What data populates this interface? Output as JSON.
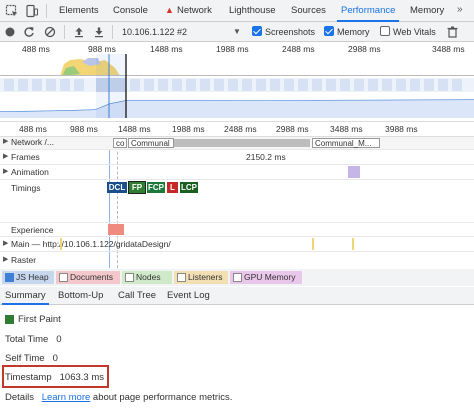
{
  "tabs": [
    "Elements",
    "Console",
    "Network",
    "Lighthouse",
    "Sources",
    "Performance",
    "Memory"
  ],
  "active_tab": "Performance",
  "toolbar": {
    "recording": "10.106.1.122 #2",
    "screenshots_label": "Screenshots",
    "memory_label": "Memory",
    "web_vitals_label": "Web Vitals",
    "screenshots_checked": true,
    "memory_checked": true,
    "web_vitals_checked": false
  },
  "overview": {
    "ticks": [
      "488 ms",
      "988 ms",
      "1488 ms",
      "1988 ms",
      "2488 ms",
      "2988 ms"
    ],
    "ticks_right": "3488 ms"
  },
  "timeline_axis": [
    "488 ms",
    "988 ms",
    "1488 ms",
    "1988 ms",
    "2488 ms",
    "2988 ms",
    "3488 ms",
    "3988 ms"
  ],
  "tracks": {
    "network": "Network /...",
    "network_co": "co",
    "network_item1": "Communal",
    "network_item2": "Communal_M...",
    "frames": "Frames",
    "frames_value": "2150.2 ms",
    "animation": "Animation",
    "timings": "Timings",
    "experience": "Experience",
    "main": "Main — http://10.106.1.122/gridataDesign/",
    "raster": "Raster"
  },
  "timing_markers": [
    "DCL",
    "FP",
    "FCP",
    "L",
    "LCP"
  ],
  "categories": [
    "JS Heap",
    "Documents",
    "Nodes",
    "Listeners",
    "GPU Memory"
  ],
  "bottom_tabs": [
    "Summary",
    "Bottom-Up",
    "Call Tree",
    "Event Log"
  ],
  "active_bottom_tab": "Summary",
  "summary": {
    "event": "First Paint",
    "total_time_label": "Total Time",
    "total_time_value": "0",
    "self_time_label": "Self Time",
    "self_time_value": "0",
    "timestamp_label": "Timestamp",
    "timestamp_value": "1063.3 ms",
    "details_label": "Details",
    "learn_more": "Learn more",
    "details_text": "about page performance metrics."
  },
  "colors": {
    "accent": "#1a73e8",
    "dcl": "#1a4f8b",
    "fp": "#2e7d32",
    "fcp": "#1b7a3a",
    "l": "#c62828",
    "lcp": "#1b5e20",
    "experience": "#ef8b7e",
    "highlight_box": "#c0392b"
  }
}
